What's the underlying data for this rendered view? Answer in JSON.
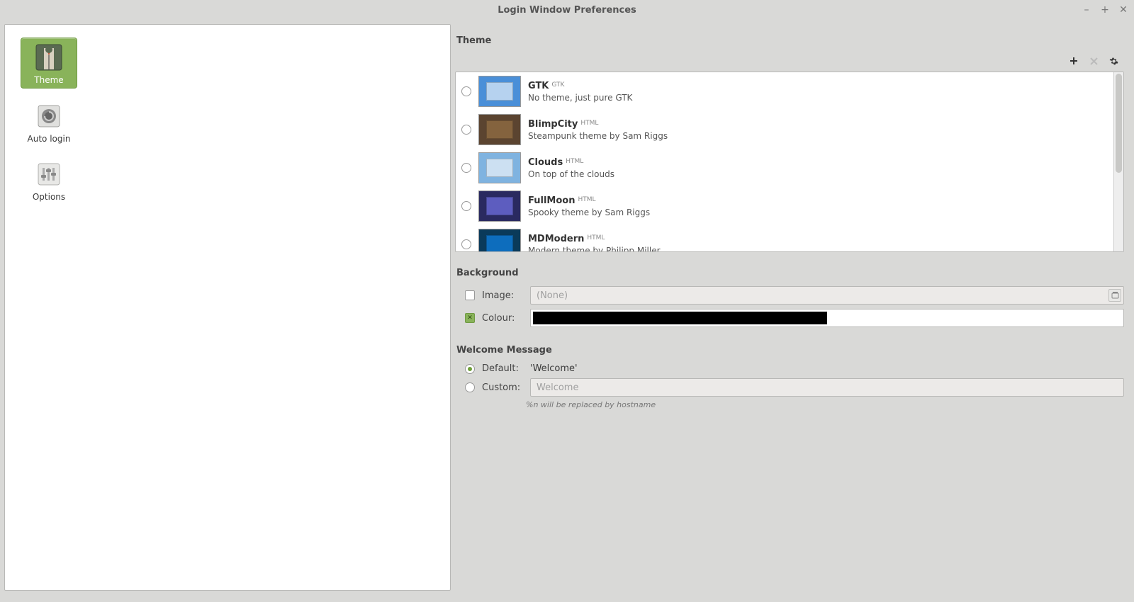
{
  "window": {
    "title": "Login Window Preferences"
  },
  "sidebar": {
    "items": [
      {
        "label": "Theme"
      },
      {
        "label": "Auto login"
      },
      {
        "label": "Options"
      }
    ]
  },
  "sections": {
    "theme": "Theme",
    "background": "Background",
    "welcome": "Welcome Message"
  },
  "themes": [
    {
      "name": "GTK",
      "badge": "GTK",
      "desc": "No theme, just pure GTK",
      "thumb": {
        "bg": "#4a8fd8",
        "accent": "#fff"
      }
    },
    {
      "name": "BlimpCity",
      "badge": "HTML",
      "desc": "Steampunk theme by Sam Riggs",
      "thumb": {
        "bg": "#5b4430",
        "accent": "#a07848"
      }
    },
    {
      "name": "Clouds",
      "badge": "HTML",
      "desc": "On top of the clouds",
      "thumb": {
        "bg": "#7fb3e0",
        "accent": "#fff"
      }
    },
    {
      "name": "FullMoon",
      "badge": "HTML",
      "desc": "Spooky theme by Sam Riggs",
      "thumb": {
        "bg": "#2a2a60",
        "accent": "#8080ff"
      }
    },
    {
      "name": "MDModern",
      "badge": "HTML",
      "desc": "Modern theme by Philipp Miller",
      "thumb": {
        "bg": "#0a3a5a",
        "accent": "#1090ff"
      }
    }
  ],
  "background": {
    "image_label": "Image:",
    "image_value": "(None)",
    "colour_label": "Colour:",
    "colour_value": "#000000"
  },
  "welcome": {
    "default_label": "Default:",
    "default_value": "'Welcome'",
    "custom_label": "Custom:",
    "custom_placeholder": "Welcome",
    "hint": "%n will be replaced by hostname"
  }
}
